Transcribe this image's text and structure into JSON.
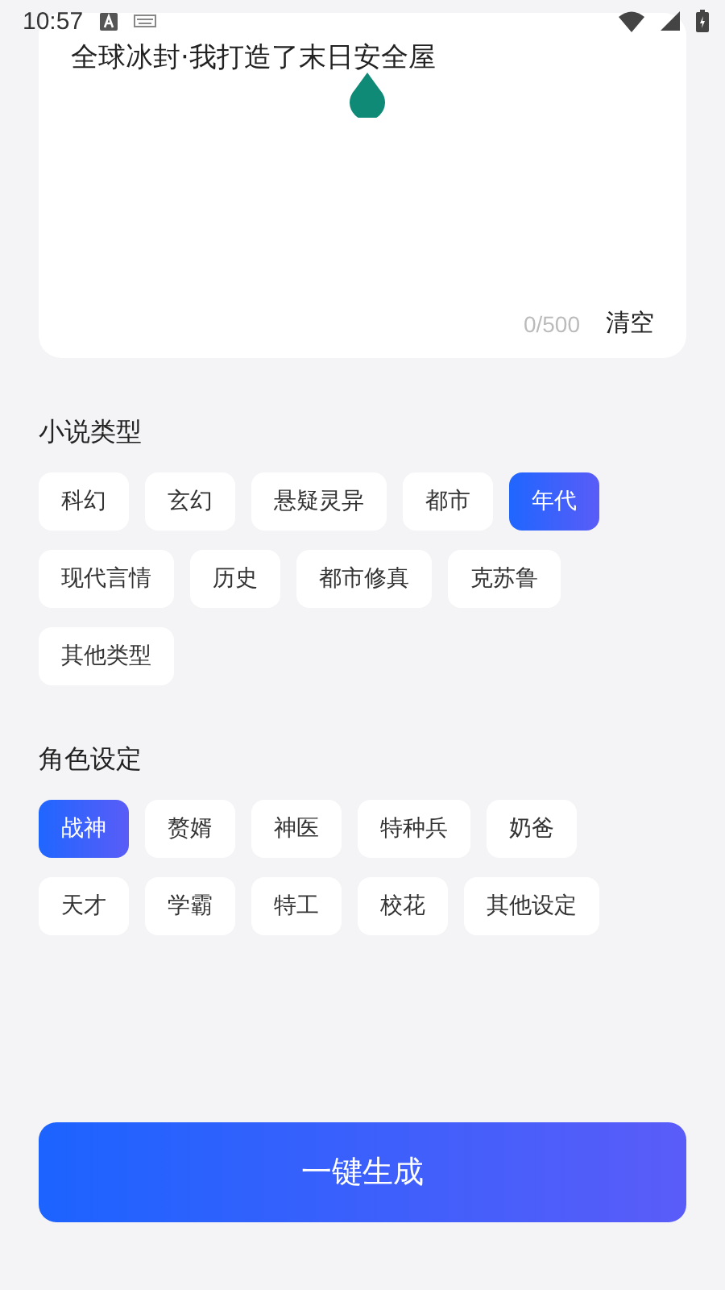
{
  "status_bar": {
    "time": "10:57"
  },
  "prompt": {
    "value": "全球冰封·我打造了末日安全屋",
    "counter": "0/500",
    "clear_label": "清空"
  },
  "sections": [
    {
      "title": "小说类型",
      "tags": [
        {
          "label": "科幻",
          "selected": false
        },
        {
          "label": "玄幻",
          "selected": false
        },
        {
          "label": "悬疑灵异",
          "selected": false
        },
        {
          "label": "都市",
          "selected": false
        },
        {
          "label": "年代",
          "selected": true
        },
        {
          "label": "现代言情",
          "selected": false
        },
        {
          "label": "历史",
          "selected": false
        },
        {
          "label": "都市修真",
          "selected": false
        },
        {
          "label": "克苏鲁",
          "selected": false
        },
        {
          "label": "其他类型",
          "selected": false
        }
      ]
    },
    {
      "title": "角色设定",
      "tags": [
        {
          "label": "战神",
          "selected": true
        },
        {
          "label": "赘婿",
          "selected": false
        },
        {
          "label": "神医",
          "selected": false
        },
        {
          "label": "特种兵",
          "selected": false
        },
        {
          "label": "奶爸",
          "selected": false
        },
        {
          "label": "天才",
          "selected": false
        },
        {
          "label": "学霸",
          "selected": false
        },
        {
          "label": "特工",
          "selected": false
        },
        {
          "label": "校花",
          "selected": false
        },
        {
          "label": "其他设定",
          "selected": false
        }
      ]
    }
  ],
  "generate_button": {
    "label": "一键生成"
  }
}
